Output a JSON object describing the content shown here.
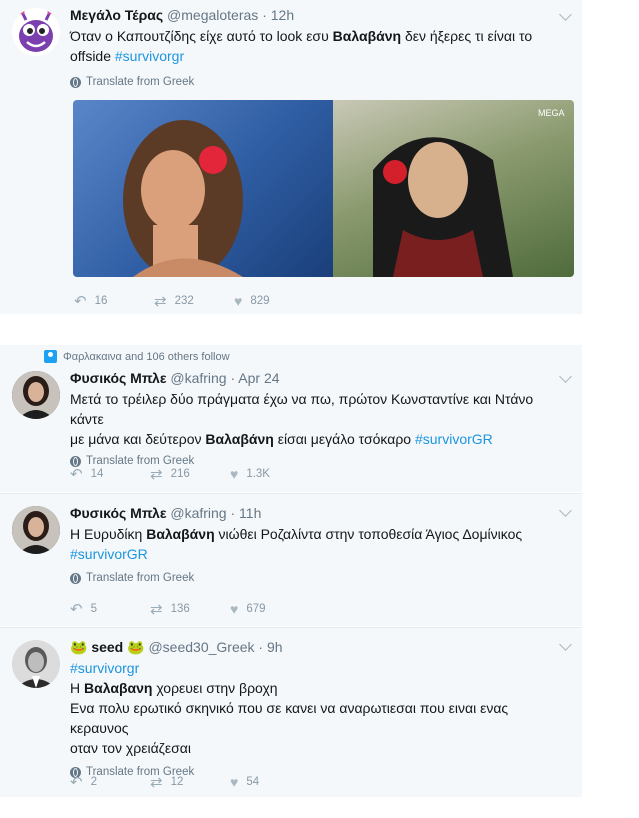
{
  "tweets": [
    {
      "name": "Μεγάλο Τέρας",
      "handle": "@megaloteras",
      "time": "12h",
      "text_parts": [
        "Όταν ο Καπουτζίδης είχε αυτό το look εσυ ",
        "Βαλαβάνη",
        " δεν ήξερες τι είναι το"
      ],
      "text_line2": "offside ",
      "hashtag": "#survivorgr",
      "translate": "Translate from Greek",
      "replies": "16",
      "retweets": "232",
      "likes": "829"
    },
    {
      "context": "Φαρλακαινα and 106 others follow",
      "name": "Φυσικός Μπλε",
      "handle": "@kafring",
      "time": "Apr 24",
      "line1": "Μετά το τρέιλερ δύο πράγματα έχω να πω, πρώτον Κωνσταντίνε και Ντάνο κάντε",
      "line2_parts": [
        "με μάνα και δεύτερον ",
        "Βαλαβάνη",
        " είσαι μεγάλο τσόκαρο "
      ],
      "hashtag": "#survivorGR",
      "translate": "Translate from Greek",
      "replies": "14",
      "retweets": "216",
      "likes": "1.3K"
    },
    {
      "name": "Φυσικός Μπλε",
      "handle": "@kafring",
      "time": "11h",
      "line1_parts": [
        "Η Ευρυδίκη ",
        "Βαλαβάνη",
        " νιώθει Ροζαλίντα στην τοποθεσία Άγιος Δομίνικος"
      ],
      "hashtag": "#survivorGR",
      "translate": "Translate from Greek",
      "replies": "5",
      "retweets": "136",
      "likes": "679"
    },
    {
      "name": "seed",
      "handle": "@seed30_Greek",
      "time": "9h",
      "hashtag": "#survivorgr",
      "line2_parts": [
        "Η ",
        "Βαλαβανη",
        " χορευει στην βροχη"
      ],
      "line3": "Ενα πολυ ερωτικό σκηνικό που σε κανει να αναρωτιεσαι που ειναι ενας κεραυνος",
      "line4": "οταν τον χρειάζεσαι",
      "translate": "Translate from Greek",
      "replies": "2",
      "retweets": "12",
      "likes": "54"
    }
  ],
  "icons": {
    "reply": "reply-icon",
    "retweet": "retweet-icon",
    "like": "heart-icon"
  },
  "colors": {
    "link": "#1b95e0",
    "muted": "#657786",
    "bg": "#f5f8fa"
  }
}
